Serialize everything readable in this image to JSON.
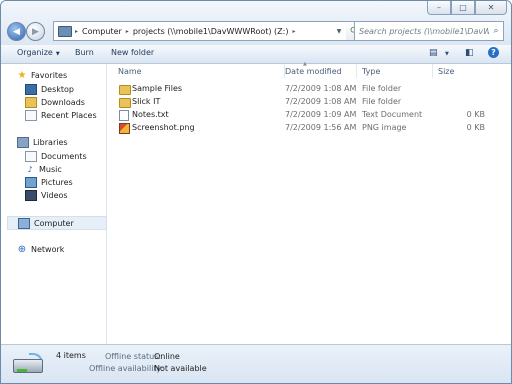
{
  "window": {
    "controls": {
      "minimize": "–",
      "maximize": "□",
      "close": "✕"
    }
  },
  "address_bar": {
    "crumbs": [
      "Computer",
      "projects (\\\\mobile1\\DavWWWRoot) (Z:)"
    ],
    "separator": "▸"
  },
  "search": {
    "placeholder": "Search projects (\\\\mobile1\\DavWWW..."
  },
  "toolbar": {
    "organize": "Organize",
    "burn": "Burn",
    "new_folder": "New folder",
    "help": "?"
  },
  "nav": {
    "favorites_header": "Favorites",
    "favorites": [
      "Desktop",
      "Downloads",
      "Recent Places"
    ],
    "libraries_header": "Libraries",
    "libraries": [
      "Documents",
      "Music",
      "Pictures",
      "Videos"
    ],
    "computer": "Computer",
    "network": "Network"
  },
  "columns": {
    "name": "Name",
    "date": "Date modified",
    "type": "Type",
    "size": "Size"
  },
  "files": [
    {
      "name": "Sample Files",
      "date": "7/2/2009 1:08 AM",
      "type": "File folder",
      "size": "",
      "icon": "folder-icon"
    },
    {
      "name": "Slick IT",
      "date": "7/2/2009 1:08 AM",
      "type": "File folder",
      "size": "",
      "icon": "folder-icon"
    },
    {
      "name": "Notes.txt",
      "date": "7/2/2009 1:09 AM",
      "type": "Text Document",
      "size": "0 KB",
      "icon": "text-file-icon"
    },
    {
      "name": "Screenshot.png",
      "date": "7/2/2009 1:56 AM",
      "type": "PNG image",
      "size": "0 KB",
      "icon": "image-file-icon"
    }
  ],
  "status": {
    "count": "4 items",
    "offline_status_label": "Offline status:",
    "offline_status_value": "Online",
    "offline_avail_label": "Offline availability:",
    "offline_avail_value": "Not available"
  }
}
